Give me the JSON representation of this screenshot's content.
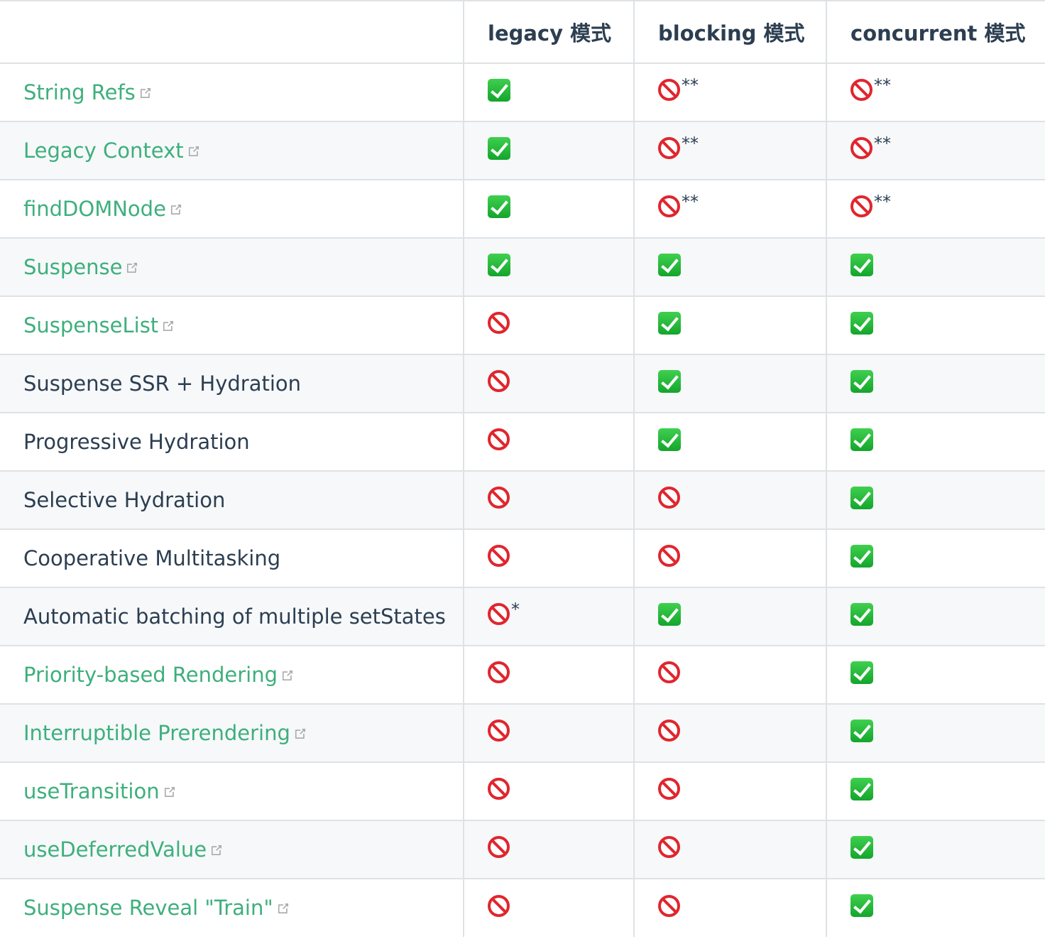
{
  "header": {
    "feature": "",
    "legacy": "legacy 模式",
    "blocking": "blocking 模式",
    "concurrent": "concurrent 模式"
  },
  "icons": {
    "ok": "white-heavy-check-mark",
    "no": "no-entry-sign",
    "external": "external-link-icon"
  },
  "colors": {
    "link": "#3eaf7c",
    "text": "#2c3e50",
    "border": "#dfe2e5",
    "stripe": "#f6f8fa"
  },
  "rows": [
    {
      "feature": "String Refs",
      "link": true,
      "legacy": "ok",
      "blocking": "no",
      "blocking_note": "**",
      "concurrent": "no",
      "concurrent_note": "**"
    },
    {
      "feature": "Legacy Context",
      "link": true,
      "legacy": "ok",
      "blocking": "no",
      "blocking_note": "**",
      "concurrent": "no",
      "concurrent_note": "**"
    },
    {
      "feature": "findDOMNode",
      "link": true,
      "legacy": "ok",
      "blocking": "no",
      "blocking_note": "**",
      "concurrent": "no",
      "concurrent_note": "**"
    },
    {
      "feature": "Suspense",
      "link": true,
      "legacy": "ok",
      "blocking": "ok",
      "concurrent": "ok"
    },
    {
      "feature": "SuspenseList",
      "link": true,
      "legacy": "no",
      "blocking": "ok",
      "concurrent": "ok"
    },
    {
      "feature": "Suspense SSR + Hydration",
      "link": false,
      "legacy": "no",
      "blocking": "ok",
      "concurrent": "ok"
    },
    {
      "feature": "Progressive Hydration",
      "link": false,
      "legacy": "no",
      "blocking": "ok",
      "concurrent": "ok"
    },
    {
      "feature": "Selective Hydration",
      "link": false,
      "legacy": "no",
      "blocking": "no",
      "concurrent": "ok"
    },
    {
      "feature": "Cooperative Multitasking",
      "link": false,
      "legacy": "no",
      "blocking": "no",
      "concurrent": "ok"
    },
    {
      "feature": "Automatic batching of multiple setStates",
      "link": false,
      "legacy": "no",
      "legacy_note": "*",
      "blocking": "ok",
      "concurrent": "ok"
    },
    {
      "feature": "Priority-based Rendering",
      "link": true,
      "legacy": "no",
      "blocking": "no",
      "concurrent": "ok"
    },
    {
      "feature": "Interruptible Prerendering",
      "link": true,
      "legacy": "no",
      "blocking": "no",
      "concurrent": "ok"
    },
    {
      "feature": "useTransition",
      "link": true,
      "legacy": "no",
      "blocking": "no",
      "concurrent": "ok"
    },
    {
      "feature": "useDeferredValue",
      "link": true,
      "legacy": "no",
      "blocking": "no",
      "concurrent": "ok"
    },
    {
      "feature": "Suspense Reveal \"Train\"",
      "link": true,
      "legacy": "no",
      "blocking": "no",
      "concurrent": "ok"
    }
  ]
}
